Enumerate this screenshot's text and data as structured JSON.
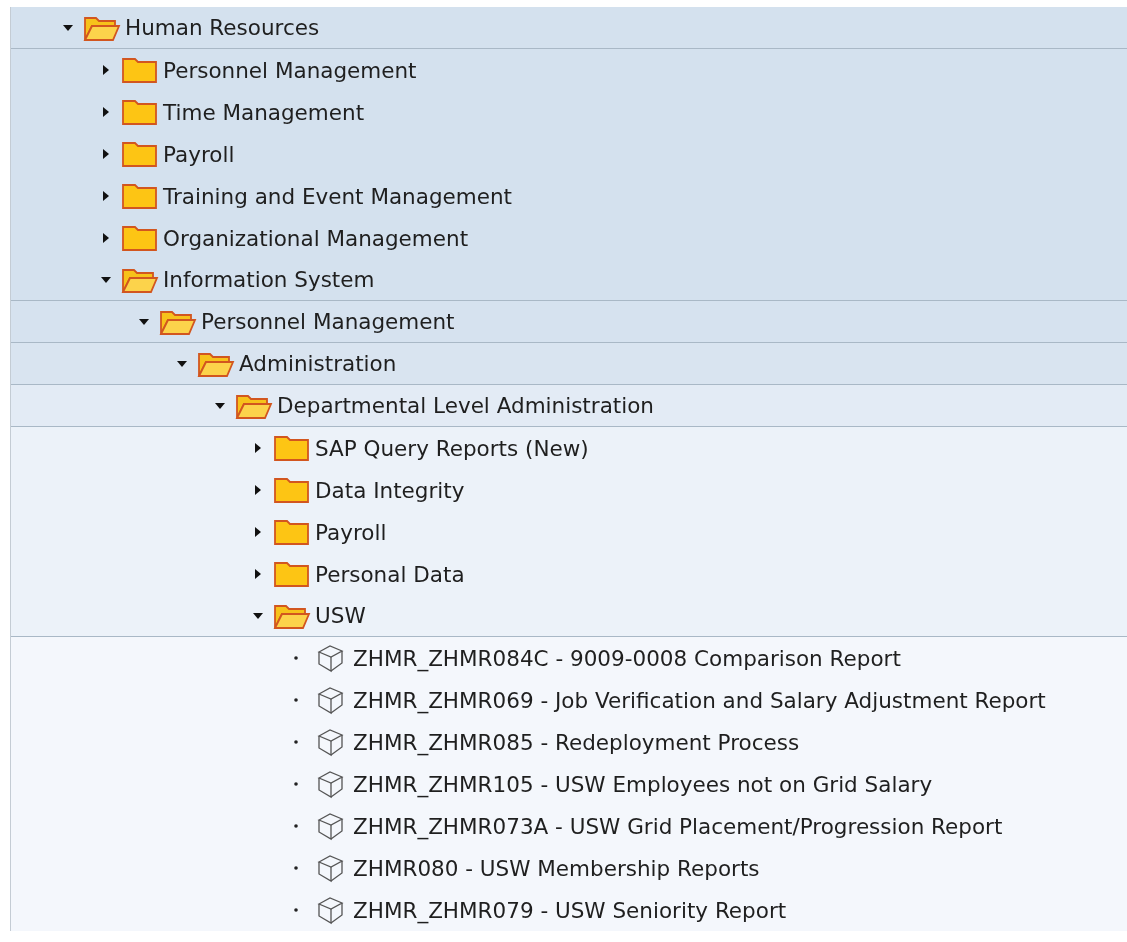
{
  "tree": [
    {
      "label": "Human Resources",
      "kind": "folder",
      "expanded": true,
      "children": [
        {
          "label": "Personnel Management",
          "kind": "folder",
          "expanded": false
        },
        {
          "label": "Time Management",
          "kind": "folder",
          "expanded": false
        },
        {
          "label": "Payroll",
          "kind": "folder",
          "expanded": false
        },
        {
          "label": "Training and Event Management",
          "kind": "folder",
          "expanded": false
        },
        {
          "label": "Organizational Management",
          "kind": "folder",
          "expanded": false
        },
        {
          "label": "Information System",
          "kind": "folder",
          "expanded": true,
          "children": [
            {
              "label": "Personnel Management",
              "kind": "folder",
              "expanded": true,
              "children": [
                {
                  "label": "Administration",
                  "kind": "folder",
                  "expanded": true,
                  "children": [
                    {
                      "label": "Departmental Level Administration",
                      "kind": "folder",
                      "expanded": true,
                      "children": [
                        {
                          "label": "SAP Query Reports (New)",
                          "kind": "folder",
                          "expanded": false
                        },
                        {
                          "label": "Data Integrity",
                          "kind": "folder",
                          "expanded": false
                        },
                        {
                          "label": "Payroll",
                          "kind": "folder",
                          "expanded": false
                        },
                        {
                          "label": "Personal Data",
                          "kind": "folder",
                          "expanded": false
                        },
                        {
                          "label": "USW",
                          "kind": "folder",
                          "expanded": true,
                          "children": [
                            {
                              "label": "ZHMR_ZHMR084C - 9009-0008 Comparison Report",
                              "kind": "transaction"
                            },
                            {
                              "label": "ZHMR_ZHMR069 - Job Verification and Salary Adjustment Report",
                              "kind": "transaction"
                            },
                            {
                              "label": "ZHMR_ZHMR085 - Redeployment Process",
                              "kind": "transaction"
                            },
                            {
                              "label": "ZHMR_ZHMR105 - USW Employees not on Grid Salary",
                              "kind": "transaction"
                            },
                            {
                              "label": "ZHMR_ZHMR073A - USW Grid Placement/Progression Report",
                              "kind": "transaction"
                            },
                            {
                              "label": "ZHMR080 - USW Membership Reports",
                              "kind": "transaction"
                            },
                            {
                              "label": "ZHMR_ZHMR079 - USW Seniority Report",
                              "kind": "transaction"
                            }
                          ]
                        }
                      ]
                    }
                  ]
                }
              ]
            }
          ]
        }
      ]
    }
  ]
}
